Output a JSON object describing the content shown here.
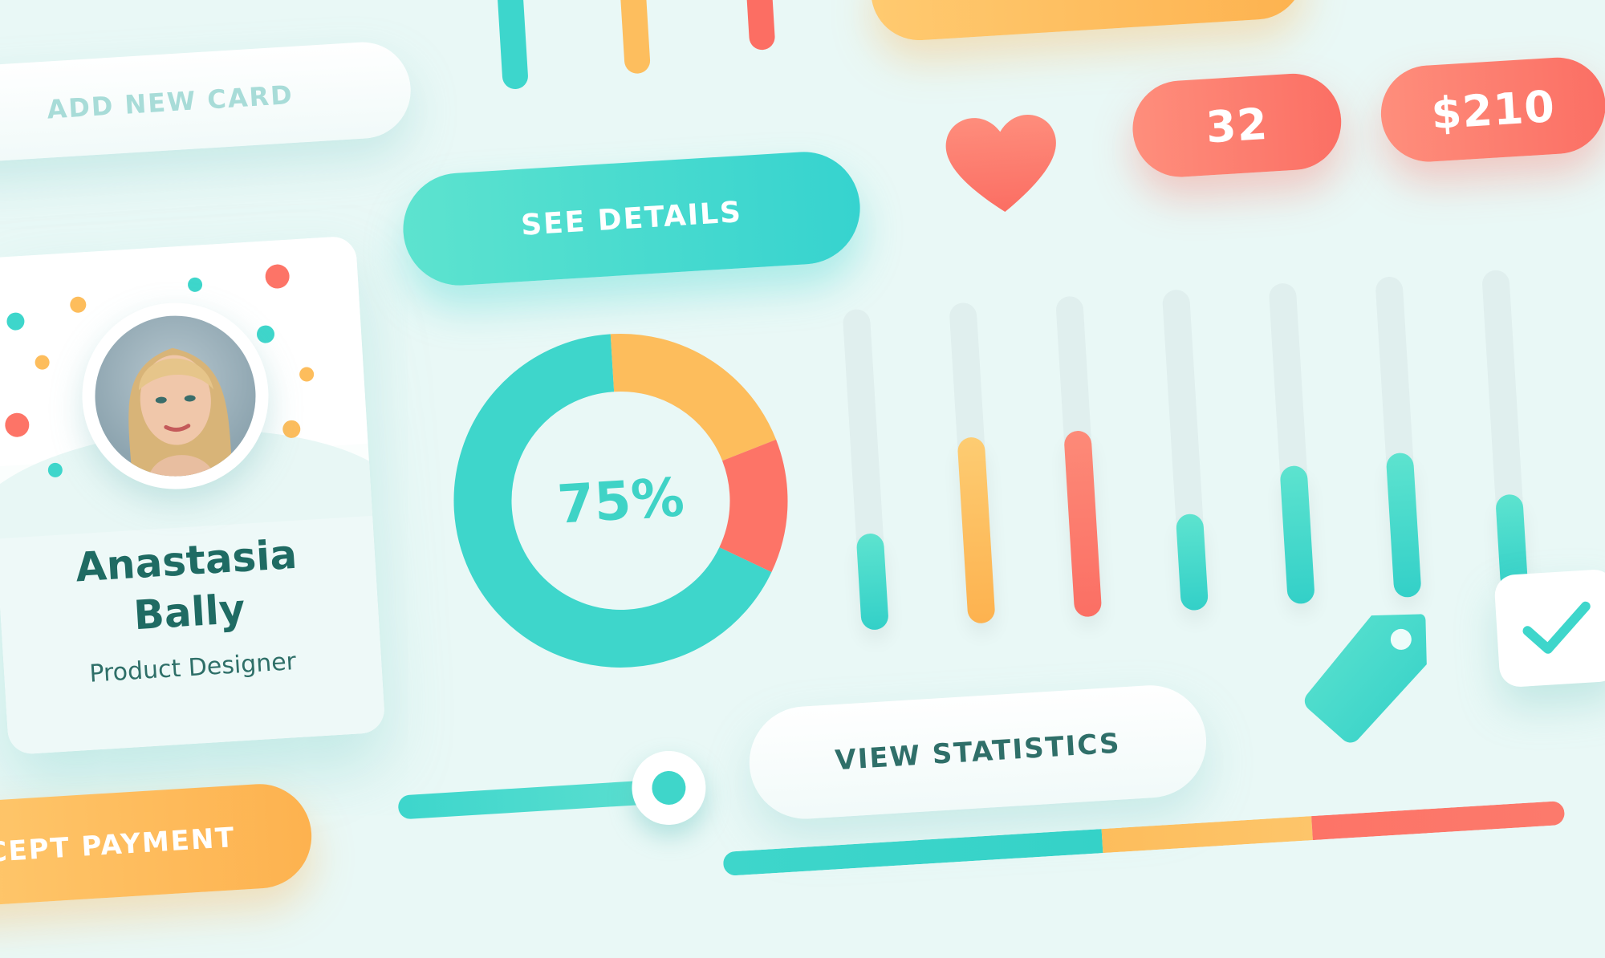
{
  "buttons": {
    "add_new_card": "ADD NEW CARD",
    "see_details": "SEE DETAILS",
    "view_statistics": "VIEW STATISTICS",
    "accept_payment": "CEPT PAYMENT"
  },
  "badges": {
    "count": "32",
    "price": "$210"
  },
  "profile_card": {
    "name": "Anastasia\nBally",
    "role": "Product Designer"
  },
  "donut": {
    "label": "75%",
    "progress": 0.75,
    "colors": {
      "main": "#3ed6cb",
      "orange": "#fdbd5c",
      "coral": "#fd7467"
    }
  },
  "progress_bars": [
    {
      "level": 0.3,
      "color": "teal"
    },
    {
      "level": 0.58,
      "color": "orange"
    },
    {
      "level": 0.58,
      "color": "coral"
    },
    {
      "level": 0.3,
      "color": "teal"
    },
    {
      "level": 0.43,
      "color": "teal"
    },
    {
      "level": 0.45,
      "color": "teal"
    },
    {
      "level": 0.3,
      "color": "teal"
    }
  ],
  "slider": {
    "level": 0.85
  },
  "checkbox": {
    "checked": true
  },
  "colors": {
    "teal": "#3ed6cb",
    "orange": "#fdb24f",
    "coral": "#fb6f64",
    "background": "#e9f8f6",
    "text_dark": "#1f6b63"
  },
  "icons": {
    "heart": "heart-icon",
    "tag": "price-tag-icon",
    "check": "checkmark-icon"
  }
}
